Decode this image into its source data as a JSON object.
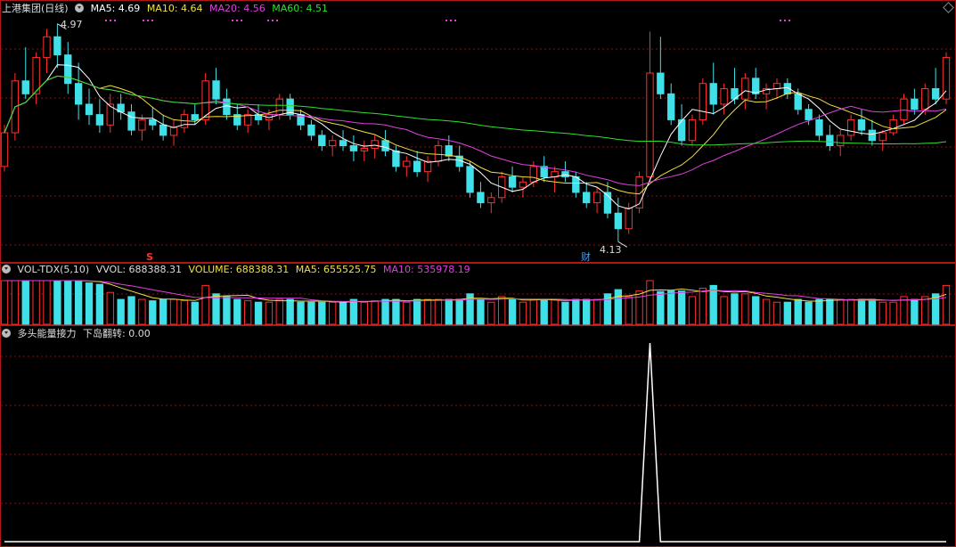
{
  "main_panel": {
    "title": "上港集团(日线)",
    "indicators": [
      {
        "label": "MA5: 4.69",
        "color": "#ffffff"
      },
      {
        "label": "MA10: 4.64",
        "color": "#f0e040"
      },
      {
        "label": "MA20: 4.56",
        "color": "#e040e0"
      },
      {
        "label": "MA60: 4.51",
        "color": "#30e030"
      }
    ],
    "high_label": "4.97",
    "low_label": "4.13",
    "marker_s": "S",
    "marker_cai": "财"
  },
  "volume_panel": {
    "title": "VOL-TDX(5,10)",
    "indicators": [
      {
        "label": "VVOL: 688388.31",
        "color": "#dddddd"
      },
      {
        "label": "VOLUME: 688388.31",
        "color": "#f0e040"
      },
      {
        "label": "MA5: 655525.75",
        "color": "#f0e040"
      },
      {
        "label": "MA10: 535978.19",
        "color": "#e040e0"
      }
    ]
  },
  "signal_panel": {
    "title": "多头能量接力",
    "indicators": [
      {
        "label": "下岛翻转: 0.00",
        "color": "#dddddd"
      }
    ]
  },
  "colors": {
    "up": "#ff3030",
    "down": "#40e0e8",
    "grid": "#8a1010",
    "border": "#b01818"
  },
  "chart_data": [
    {
      "type": "candlestick",
      "title": "上港集团(日线)",
      "series": [
        {
          "name": "MA5",
          "value": 4.69
        },
        {
          "name": "MA10",
          "value": 4.64
        },
        {
          "name": "MA20",
          "value": 4.56
        },
        {
          "name": "MA60",
          "value": 4.51
        }
      ],
      "annotations": [
        {
          "text": "4.97",
          "kind": "period high"
        },
        {
          "text": "4.13",
          "kind": "period low"
        }
      ],
      "ohlc": [
        [
          4.42,
          4.58,
          4.4,
          4.55
        ],
        [
          4.55,
          4.78,
          4.52,
          4.75
        ],
        [
          4.75,
          4.88,
          4.68,
          4.7
        ],
        [
          4.7,
          4.86,
          4.66,
          4.84
        ],
        [
          4.84,
          4.95,
          4.78,
          4.92
        ],
        [
          4.92,
          4.97,
          4.8,
          4.85
        ],
        [
          4.85,
          4.9,
          4.7,
          4.74
        ],
        [
          4.74,
          4.82,
          4.6,
          4.66
        ],
        [
          4.66,
          4.72,
          4.58,
          4.62
        ],
        [
          4.62,
          4.68,
          4.55,
          4.58
        ],
        [
          4.58,
          4.7,
          4.55,
          4.66
        ],
        [
          4.66,
          4.7,
          4.6,
          4.63
        ],
        [
          4.63,
          4.66,
          4.54,
          4.56
        ],
        [
          4.56,
          4.62,
          4.52,
          4.6
        ],
        [
          4.6,
          4.65,
          4.56,
          4.58
        ],
        [
          4.58,
          4.62,
          4.52,
          4.54
        ],
        [
          4.54,
          4.6,
          4.5,
          4.57
        ],
        [
          4.57,
          4.64,
          4.55,
          4.62
        ],
        [
          4.62,
          4.66,
          4.58,
          4.6
        ],
        [
          4.6,
          4.78,
          4.58,
          4.75
        ],
        [
          4.75,
          4.8,
          4.66,
          4.68
        ],
        [
          4.68,
          4.72,
          4.6,
          4.62
        ],
        [
          4.62,
          4.66,
          4.56,
          4.58
        ],
        [
          4.58,
          4.64,
          4.55,
          4.62
        ],
        [
          4.62,
          4.66,
          4.58,
          4.6
        ],
        [
          4.6,
          4.64,
          4.56,
          4.62
        ],
        [
          4.62,
          4.7,
          4.6,
          4.68
        ],
        [
          4.68,
          4.7,
          4.6,
          4.62
        ],
        [
          4.62,
          4.64,
          4.56,
          4.58
        ],
        [
          4.58,
          4.6,
          4.52,
          4.54
        ],
        [
          4.54,
          4.56,
          4.48,
          4.5
        ],
        [
          4.5,
          4.54,
          4.46,
          4.52
        ],
        [
          4.52,
          4.56,
          4.48,
          4.5
        ],
        [
          4.5,
          4.54,
          4.44,
          4.48
        ],
        [
          4.48,
          4.52,
          4.44,
          4.49
        ],
        [
          4.49,
          4.54,
          4.45,
          4.52
        ],
        [
          4.52,
          4.56,
          4.46,
          4.48
        ],
        [
          4.48,
          4.5,
          4.4,
          4.42
        ],
        [
          4.42,
          4.46,
          4.38,
          4.44
        ],
        [
          4.44,
          4.48,
          4.38,
          4.4
        ],
        [
          4.4,
          4.46,
          4.36,
          4.44
        ],
        [
          4.44,
          4.52,
          4.42,
          4.5
        ],
        [
          4.5,
          4.54,
          4.44,
          4.46
        ],
        [
          4.46,
          4.5,
          4.4,
          4.42
        ],
        [
          4.42,
          4.44,
          4.3,
          4.32
        ],
        [
          4.32,
          4.36,
          4.26,
          4.28
        ],
        [
          4.28,
          4.32,
          4.24,
          4.3
        ],
        [
          4.3,
          4.4,
          4.28,
          4.38
        ],
        [
          4.38,
          4.42,
          4.32,
          4.34
        ],
        [
          4.34,
          4.38,
          4.3,
          4.36
        ],
        [
          4.36,
          4.44,
          4.34,
          4.42
        ],
        [
          4.42,
          4.46,
          4.36,
          4.38
        ],
        [
          4.38,
          4.42,
          4.32,
          4.4
        ],
        [
          4.4,
          4.44,
          4.36,
          4.38
        ],
        [
          4.38,
          4.4,
          4.3,
          4.32
        ],
        [
          4.32,
          4.36,
          4.26,
          4.28
        ],
        [
          4.28,
          4.34,
          4.24,
          4.32
        ],
        [
          4.32,
          4.36,
          4.22,
          4.24
        ],
        [
          4.24,
          4.3,
          4.13,
          4.18
        ],
        [
          4.18,
          4.28,
          4.16,
          4.26
        ],
        [
          4.26,
          4.4,
          4.24,
          4.38
        ],
        [
          4.38,
          4.94,
          4.36,
          4.78
        ],
        [
          4.78,
          4.92,
          4.68,
          4.7
        ],
        [
          4.7,
          4.74,
          4.58,
          4.6
        ],
        [
          4.6,
          4.66,
          4.5,
          4.52
        ],
        [
          4.52,
          4.62,
          4.5,
          4.6
        ],
        [
          4.6,
          4.76,
          4.58,
          4.74
        ],
        [
          4.74,
          4.82,
          4.62,
          4.66
        ],
        [
          4.66,
          4.74,
          4.62,
          4.72
        ],
        [
          4.72,
          4.8,
          4.66,
          4.68
        ],
        [
          4.68,
          4.78,
          4.64,
          4.76
        ],
        [
          4.76,
          4.8,
          4.68,
          4.7
        ],
        [
          4.7,
          4.74,
          4.64,
          4.72
        ],
        [
          4.72,
          4.76,
          4.68,
          4.74
        ],
        [
          4.74,
          4.76,
          4.68,
          4.7
        ],
        [
          4.7,
          4.72,
          4.62,
          4.64
        ],
        [
          4.64,
          4.66,
          4.58,
          4.6
        ],
        [
          4.6,
          4.62,
          4.52,
          4.54
        ],
        [
          4.54,
          4.58,
          4.48,
          4.5
        ],
        [
          4.5,
          4.56,
          4.46,
          4.54
        ],
        [
          4.54,
          4.62,
          4.52,
          4.6
        ],
        [
          4.6,
          4.64,
          4.54,
          4.56
        ],
        [
          4.56,
          4.6,
          4.5,
          4.52
        ],
        [
          4.52,
          4.56,
          4.48,
          4.55
        ],
        [
          4.55,
          4.62,
          4.54,
          4.6
        ],
        [
          4.6,
          4.7,
          4.58,
          4.68
        ],
        [
          4.68,
          4.72,
          4.62,
          4.64
        ],
        [
          4.64,
          4.74,
          4.62,
          4.72
        ],
        [
          4.72,
          4.8,
          4.66,
          4.68
        ],
        [
          4.68,
          4.86,
          4.66,
          4.84
        ]
      ]
    },
    {
      "type": "bar",
      "title": "VOL-TDX(5,10)",
      "series": [
        {
          "name": "VVOL",
          "value": 688388.31
        },
        {
          "name": "VOLUME",
          "value": 688388.31
        },
        {
          "name": "MA5",
          "value": 655525.75
        },
        {
          "name": "MA10",
          "value": 535978.19
        }
      ]
    },
    {
      "type": "line",
      "title": "多头能量接力",
      "series": [
        {
          "name": "下岛翻转",
          "value": 0.0,
          "spike_at_index": 61,
          "spike_value": 1
        }
      ]
    }
  ]
}
